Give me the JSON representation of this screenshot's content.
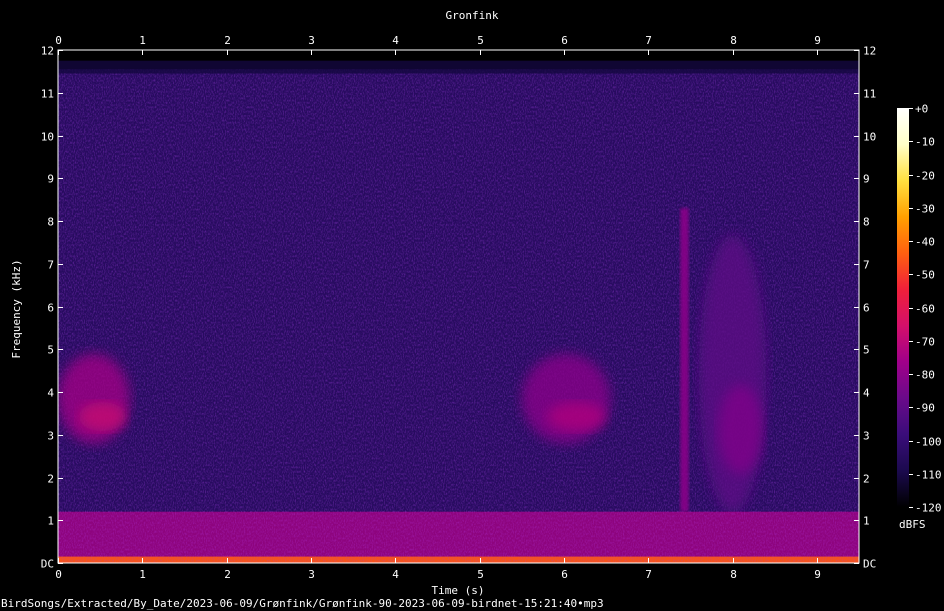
{
  "chart_data": {
    "type": "heatmap",
    "title": "Gronfink",
    "xlabel": "Time (s)",
    "ylabel": "Frequency (kHz)",
    "xlim": [
      0,
      9.5
    ],
    "ylim": [
      0,
      12
    ],
    "x_ticks": [
      "0",
      "1",
      "2",
      "3",
      "4",
      "5",
      "6",
      "7",
      "8",
      "9"
    ],
    "y_ticks": [
      "DC",
      "1",
      "2",
      "3",
      "4",
      "5",
      "6",
      "7",
      "8",
      "9",
      "10",
      "11",
      "12"
    ],
    "colorbar": {
      "label": "dBFS",
      "range": [
        -120,
        0
      ],
      "ticks": [
        "+0",
        "-10",
        "-20",
        "-30",
        "-40",
        "-50",
        "-60",
        "-70",
        "-80",
        "-90",
        "-100",
        "-110",
        "-120"
      ],
      "colormap": [
        "#000000",
        "#1b0a4e",
        "#3a0d7a",
        "#6a0a8a",
        "#a0008a",
        "#d4106a",
        "#f0203a",
        "#ff6010",
        "#ffa000",
        "#ffe040",
        "#ffffc8",
        "#ffffff"
      ]
    },
    "features": [
      {
        "t_start": 0.0,
        "t_end": 0.85,
        "f_low": 2.9,
        "f_high": 5.0,
        "level_dbfs": -75
      },
      {
        "t_start": 5.5,
        "t_end": 6.55,
        "f_low": 2.9,
        "f_high": 5.0,
        "level_dbfs": -80
      },
      {
        "t_start": 7.38,
        "t_end": 7.48,
        "f_low": 1.2,
        "f_high": 8.3,
        "level_dbfs": -80
      },
      {
        "t_start": 7.6,
        "t_end": 8.4,
        "f_low": 1.5,
        "f_high": 8.0,
        "level_dbfs": -90
      },
      {
        "t_start": 0.0,
        "t_end": 9.5,
        "f_low": 0.0,
        "f_high": 1.2,
        "level_dbfs": -75
      }
    ],
    "background_level_dbfs": -105
  },
  "footer_path": "BirdSongs/Extracted/By_Date/2023-06-09/Grønfink/Grønfink-90-2023-06-09-birdnet-15:21:40•mp3"
}
